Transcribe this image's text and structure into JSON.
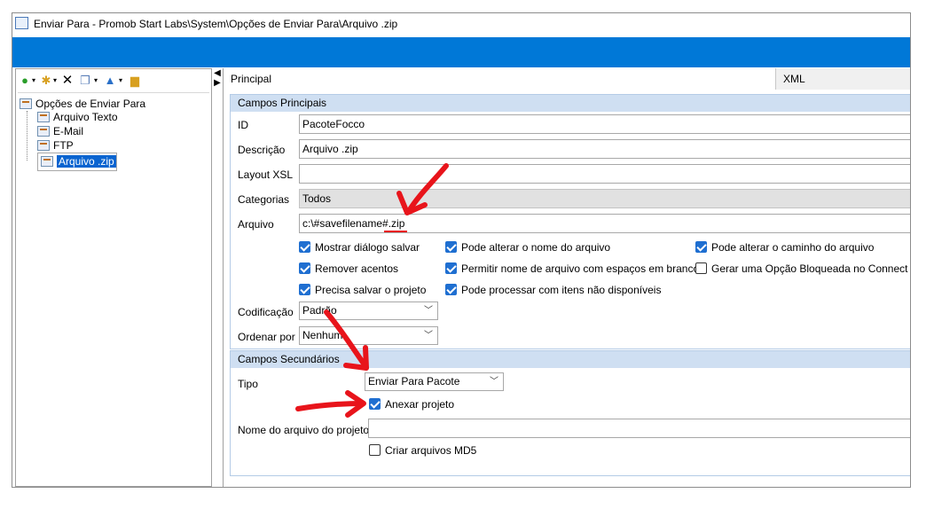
{
  "window": {
    "title": "Enviar Para - Promob Start Labs\\System\\Opções de Enviar Para\\Arquivo .zip"
  },
  "toolbar": {
    "icons": [
      "back-icon",
      "new-icon",
      "delete-icon",
      "copy-icon",
      "move-up-icon",
      "folder-icon"
    ]
  },
  "tree": {
    "root": "Opções de Enviar Para",
    "items": [
      "Arquivo Texto",
      "E-Mail",
      "FTP",
      "Arquivo .zip"
    ],
    "selected": "Arquivo .zip"
  },
  "tabs": [
    "Principal",
    "XML"
  ],
  "principal": {
    "header": "Campos Principais",
    "id_label": "ID",
    "id_value": "PacoteFocco",
    "desc_label": "Descrição",
    "desc_value": "Arquivo .zip",
    "xsl_label": "Layout XSL",
    "xsl_value": "",
    "cat_label": "Categorias",
    "cat_value": "Todos",
    "arq_label": "Arquivo",
    "arq_value": "c:\\#savefilename#.zip",
    "checks": [
      {
        "label": "Mostrar diálogo salvar",
        "checked": true
      },
      {
        "label": "Pode alterar o nome do arquivo",
        "checked": true
      },
      {
        "label": "Pode alterar o caminho do arquivo",
        "checked": true
      },
      {
        "label": "Remover acentos",
        "checked": true
      },
      {
        "label": "Permitir nome de arquivo com espaços em branco",
        "checked": true
      },
      {
        "label": "Gerar uma Opção Bloqueada no Connect",
        "checked": false
      },
      {
        "label": "Precisa salvar o projeto",
        "checked": true
      },
      {
        "label": "Pode processar com itens não disponíveis",
        "checked": true
      }
    ],
    "cod_label": "Codificação",
    "cod_value": "Padrão",
    "ord_label": "Ordenar por",
    "ord_value": "Nenhum"
  },
  "secundarios": {
    "header": "Campos Secundários",
    "tipo_label": "Tipo",
    "tipo_value": "Enviar Para Pacote",
    "anexar_label": "Anexar projeto",
    "anexar_checked": true,
    "nome_label": "Nome do arquivo do projeto",
    "nome_value": "",
    "md5_label": "Criar arquivos MD5",
    "md5_checked": false
  },
  "colors": {
    "accent": "#0078d7",
    "group_header": "#cfdff2",
    "annotation": "#e8141b"
  }
}
